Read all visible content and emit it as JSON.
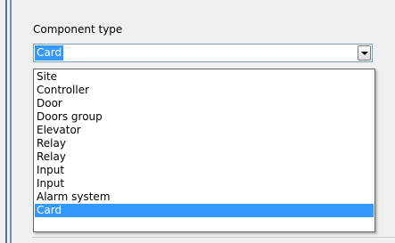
{
  "field": {
    "label": "Component type",
    "value": "Card"
  },
  "dropdown": {
    "items": [
      {
        "label": "Site",
        "selected": false
      },
      {
        "label": "Controller",
        "selected": false
      },
      {
        "label": "Door",
        "selected": false
      },
      {
        "label": "Doors group",
        "selected": false
      },
      {
        "label": "Elevator",
        "selected": false
      },
      {
        "label": "Relay",
        "selected": false
      },
      {
        "label": "Relay",
        "selected": false
      },
      {
        "label": "Input",
        "selected": false
      },
      {
        "label": "Input",
        "selected": false
      },
      {
        "label": "Alarm system",
        "selected": false
      },
      {
        "label": "Card",
        "selected": true
      }
    ]
  },
  "colors": {
    "selection": "#3399ff",
    "left_accent": "#4a6fa5"
  },
  "icons": {
    "combo_button": "chevron-down-icon"
  }
}
